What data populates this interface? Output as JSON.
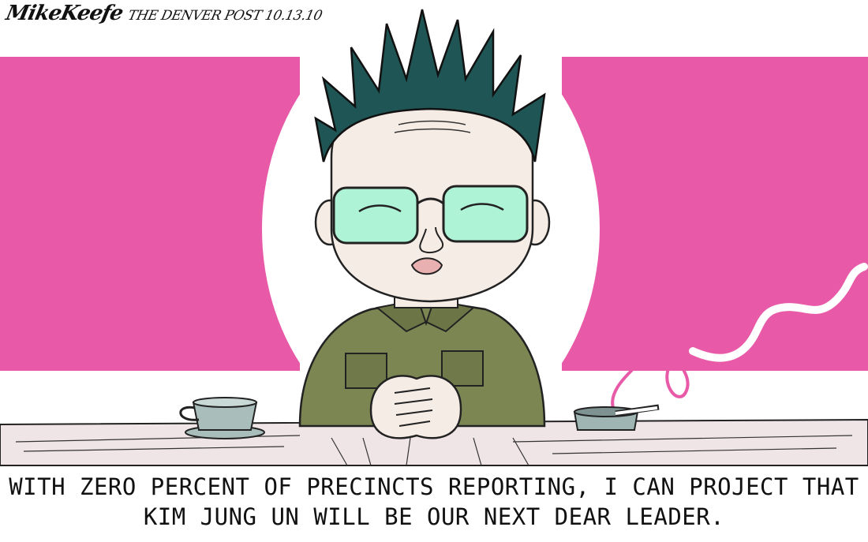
{
  "signature": {
    "artist": "MikeKeefe",
    "publication": "THE DENVER POST 10.13.10"
  },
  "caption": {
    "line1": "WITH ZERO PERCENT OF PRECINCTS REPORTING, I CAN PROJECT THAT",
    "line2": "KIM JUNG UN WILL BE OUR NEXT DEAR LEADER."
  },
  "colors": {
    "flag_magenta": "#e85aa8",
    "glasses_tint": "#aef3d6",
    "uniform_green": "#7c8653",
    "hair_teal": "#1f5554",
    "desk_pink": "#efe4e6",
    "cup_gray": "#a9bdbb"
  }
}
